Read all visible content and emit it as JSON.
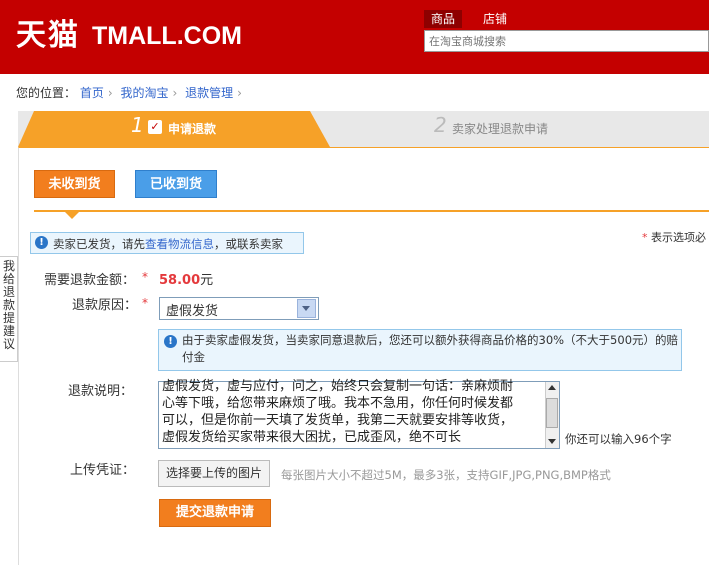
{
  "header": {
    "logo_cn": "天猫",
    "logo_en": "TMALL.COM",
    "search_tabs": [
      "商品",
      "店铺"
    ],
    "search_placeholder": "在淘宝商城搜索"
  },
  "breadcrumb": {
    "prefix": "您的位置：",
    "items": [
      "首页",
      "我的淘宝",
      "退款管理"
    ]
  },
  "steps": [
    {
      "num": "1",
      "label": "申请退款"
    },
    {
      "num": "2",
      "label": "卖家处理退款申请"
    }
  ],
  "tabs": {
    "not_received": "未收到货",
    "received": "已收到货"
  },
  "notice": {
    "pre": "卖家已发货，请先",
    "link": "查看物流信息",
    "post": "，或联系卖家"
  },
  "required_note": "表示选项必",
  "side_feedback": "我给退款提建议",
  "form": {
    "amount_label": "需要退款金额：",
    "amount_value": "58.00",
    "amount_unit": "元",
    "reason_label": "退款原因：",
    "reason_value": "虚假发货",
    "reason_info": "由于卖家虚假发货，当卖家同意退款后，您还可以额外获得商品价格的30%（不大于500元）的赔付金",
    "desc_label": "退款说明：",
    "desc_text": "虚假发货，虚与应付，问之，始终只会复制一句话：亲麻烦耐\n心等下哦，给您带来麻烦了哦。我本不急用，你任何时候发都\n可以，但是你前一天填了发货单，我第二天就要安排等收货，\n虚假发货给买家带来很大困扰，已成歪风，绝不可长",
    "desc_hint": "你还可以输入96个字",
    "upload_label": "上传凭证：",
    "upload_button": "选择要上传的图片",
    "upload_hint": "每张图片大小不超过5M，最多3张，支持GIF,JPG,PNG,BMP格式",
    "submit_button": "提交退款申请"
  }
}
